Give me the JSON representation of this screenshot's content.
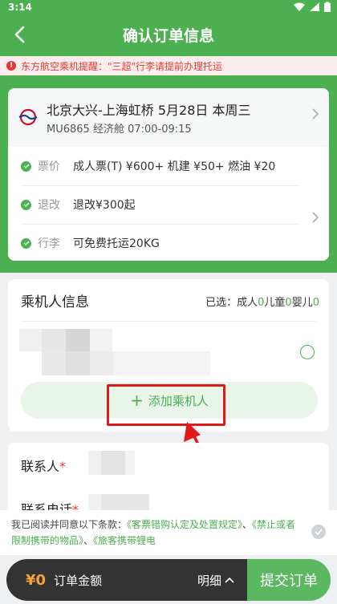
{
  "status": {
    "time": "3:14"
  },
  "nav": {
    "title": "确认订单信息"
  },
  "notice": {
    "icon_text": "!",
    "text": "东方航空乘机提醒：\"三超\"行李请提前办理托运"
  },
  "flight": {
    "route": "北京大兴-上海虹桥  5月28日  本周三",
    "sub": "MU6865  经济舱  07:00-09:15",
    "rows": [
      {
        "label": "票价",
        "value": "成人票(T) ¥600+ 机建 ¥50+ 燃油 ¥20"
      },
      {
        "label": "退改",
        "value": "退改¥300起"
      },
      {
        "label": "行李",
        "value": "可免费托运20KG"
      }
    ]
  },
  "passengers": {
    "title": "乘机人信息",
    "selected_prefix": "已选：",
    "adult_label": "成人",
    "adult_count": "0",
    "child_label": "儿童",
    "child_count": "0",
    "infant_label": "婴儿",
    "infant_count": "0",
    "add_icon": "+",
    "add_label": "添加乘机人"
  },
  "contact": {
    "name_label": "联系人",
    "phone_label": "联系电话",
    "required_mark": "*"
  },
  "terms": {
    "prefix": "我已阅读并同意以下条款：",
    "link1": "《客票错购认定及处置规定》",
    "sep1": "、",
    "link2": "《禁止或者限制携带的物品》",
    "sep2": "、",
    "link3": "《旅客携带锂电"
  },
  "bottom": {
    "price": "¥0",
    "amount_label": "订单金额",
    "detail_label": "明细",
    "submit_label": "提交订单"
  },
  "colors": {
    "brand_green": "#4caf50",
    "alert_red": "#e53935",
    "price_orange": "#f7a23b"
  }
}
